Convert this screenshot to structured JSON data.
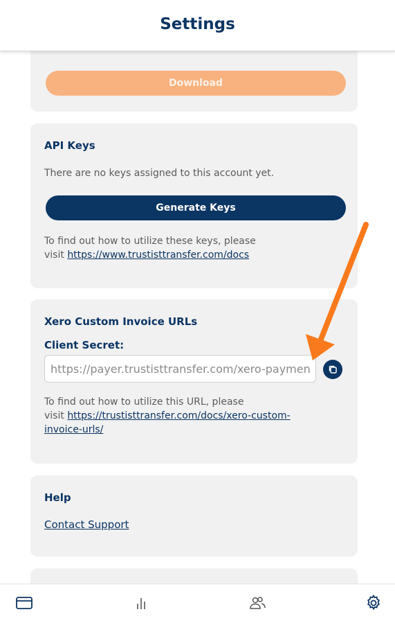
{
  "header": {
    "title": "Settings"
  },
  "download_card": {
    "button_label": "Download"
  },
  "api_keys": {
    "title": "API Keys",
    "empty_message": "There are no keys assigned to this account yet.",
    "generate_label": "Generate Keys",
    "info_line1": "To find out how to utilize these keys, please",
    "info_visit": "visit ",
    "docs_link": "https://www.trustisttransfer.com/docs"
  },
  "xero": {
    "title": "Xero Custom Invoice URLs",
    "client_secret_label": "Client Secret:",
    "client_secret_value": "https://payer.trustisttransfer.com/xero-payment",
    "info_line1": "To find out how to utilize this URL, please",
    "info_visit": "visit ",
    "docs_link_line1": "https://trustisttransfer.com/docs/xero-custom-",
    "docs_link_line2": "invoice-urls/"
  },
  "help": {
    "title": "Help",
    "contact_label": "Contact Support"
  },
  "bottom_nav": {
    "items": [
      {
        "icon": "card-icon"
      },
      {
        "icon": "bar-chart-icon"
      },
      {
        "icon": "users-icon"
      },
      {
        "icon": "gear-icon",
        "active": true
      }
    ]
  },
  "colors": {
    "primary": "#0b3563",
    "download": "#f8b27f",
    "card_bg": "#f1f1f1",
    "annotation_arrow": "#f97a1c"
  }
}
